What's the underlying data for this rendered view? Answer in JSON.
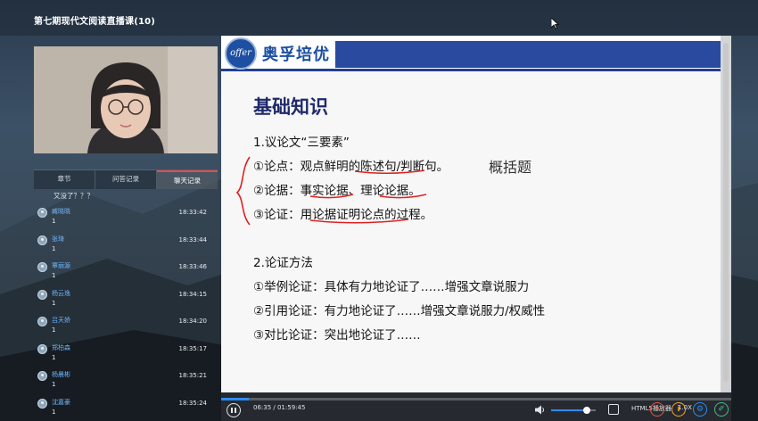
{
  "app": {
    "title": "第七期现代文阅读直播课(10)"
  },
  "tabs": [
    {
      "label": "章节",
      "active": false
    },
    {
      "label": "问答记录",
      "active": false
    },
    {
      "label": "聊天记录",
      "active": true
    }
  ],
  "chat": {
    "first_text": "又没了？？？",
    "messages": [
      {
        "name": "臧晓晓",
        "time": "18:33:42",
        "text": "1"
      },
      {
        "name": "张琦",
        "time": "18:33:44",
        "text": "1"
      },
      {
        "name": "覃丽源",
        "time": "18:33:46",
        "text": "1"
      },
      {
        "name": "杨云逸",
        "time": "18:34:15",
        "text": "1"
      },
      {
        "name": "吕天娇",
        "time": "18:34:20",
        "text": "1"
      },
      {
        "name": "郑柏森",
        "time": "18:35:17",
        "text": "1"
      },
      {
        "name": "杨晨彬",
        "time": "18:35:21",
        "text": "1"
      },
      {
        "name": "沈嘉豪",
        "time": "18:35:24",
        "text": "1"
      }
    ]
  },
  "slide": {
    "logo_mark": "offer",
    "logo_text": "奥孚培优",
    "title": "基础知识",
    "lines": [
      "1.议论文“三要素”",
      "①论点：观点鲜明的陈述句/判断句。",
      "②论据：事实论据、理论论据。",
      "③论证：用论据证明论点的过程。",
      "2.论证方法",
      "①举例论证：具体有力地论证了……增强文章说服力",
      "②引用论证：有力地论证了……增强文章说服力/权威性",
      "③对比论证：突出地论证了……"
    ],
    "handwritten_note": "概括题"
  },
  "player": {
    "time": "06:35 / 01:59:45",
    "progress": 0.055,
    "volume": 0.8,
    "player_label": "HTML5播放器",
    "speed": "1.0X"
  },
  "colors": {
    "accent": "#2d8cf0",
    "slide_title": "#1f2a6b",
    "brand": "#1d4fa3",
    "active_tab": "#e44d4d",
    "annotation": "#e02020"
  },
  "tools": [
    {
      "icon": "pencil-icon",
      "color": "#e55a3c"
    },
    {
      "icon": "info-icon",
      "color": "#f2a52c"
    },
    {
      "icon": "settings-icon",
      "color": "#2d8cf0"
    },
    {
      "icon": "edit-icon",
      "color": "#3fbf7f"
    }
  ]
}
